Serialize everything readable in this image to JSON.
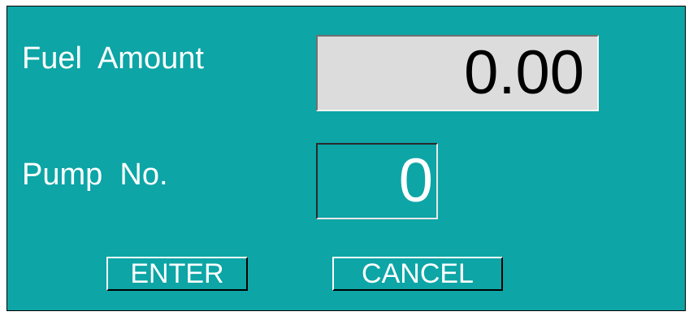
{
  "form": {
    "fuel_amount_label": "Fuel  Amount",
    "fuel_amount_value": "0.00",
    "pump_no_label": "Pump  No.",
    "pump_no_value": "0"
  },
  "buttons": {
    "enter_label": "ENTER",
    "cancel_label": "CANCEL"
  },
  "colors": {
    "panel_background": "#0da5a6",
    "amount_field_background": "#dcdcdc",
    "text": "#ffffff"
  }
}
